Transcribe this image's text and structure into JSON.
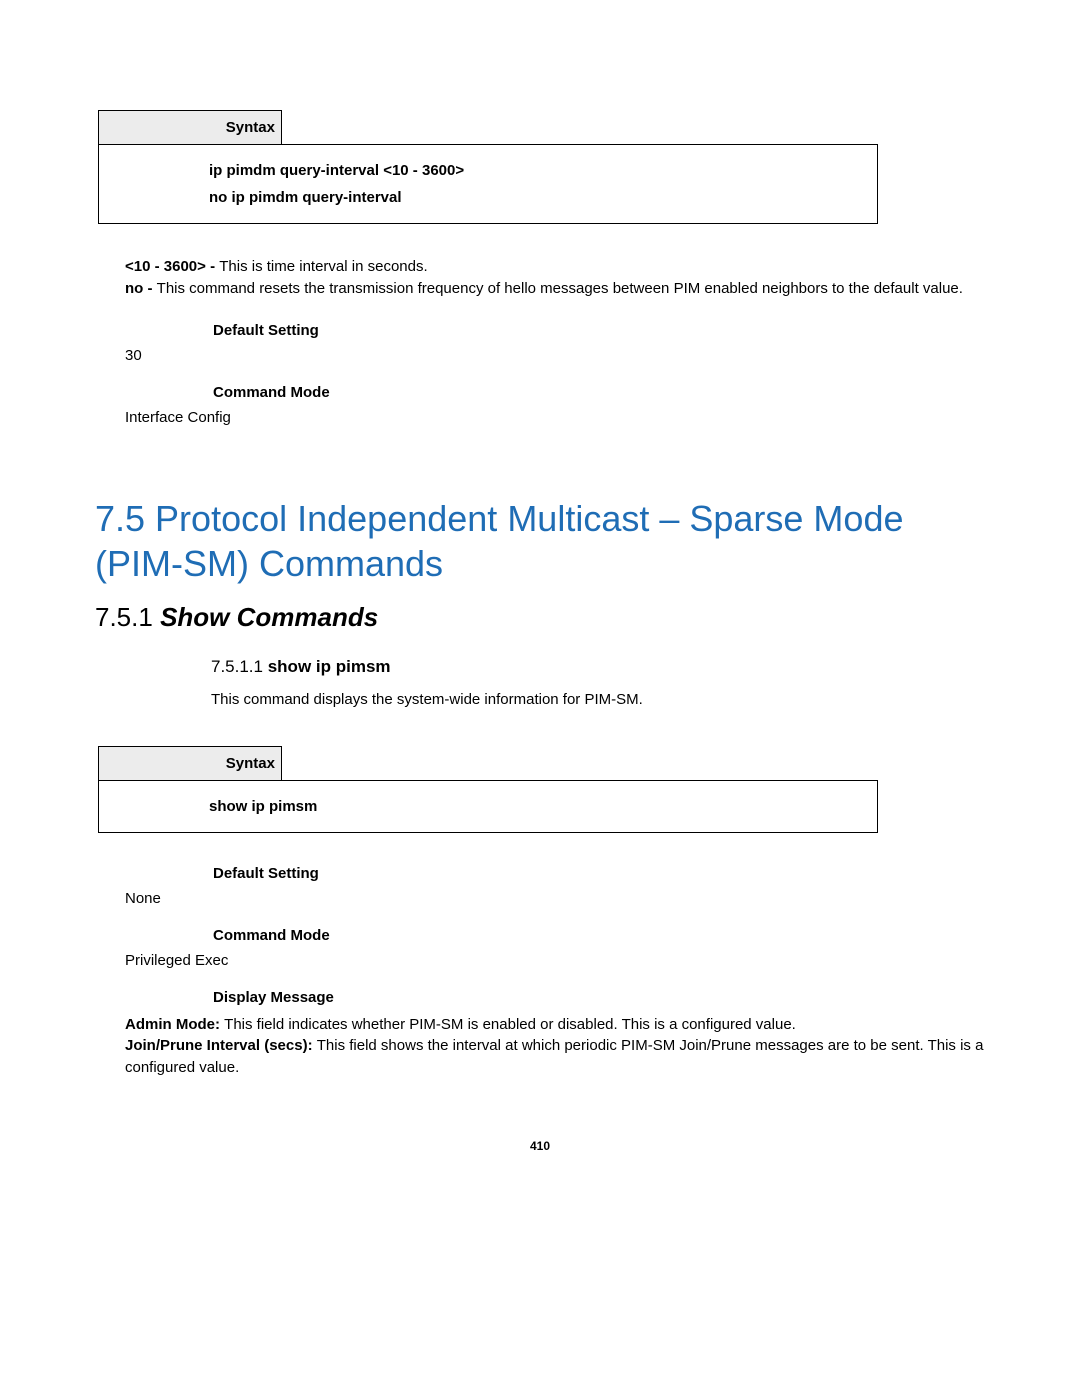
{
  "syntax1": {
    "header": "Syntax",
    "line1": "ip pimdm query-interval <10 - 3600>",
    "line2": "no ip pimdm query-interval"
  },
  "params": {
    "range_term": "<10 - 3600> - ",
    "range_text": "This is time interval in seconds.",
    "no_term": "no - ",
    "no_text": "This command resets the transmission frequency of hello messages between PIM enabled neighbors to the default value."
  },
  "labels": {
    "default_setting": "Default Setting",
    "command_mode": "Command Mode",
    "display_message": "Display Message"
  },
  "values1": {
    "default_setting": "30",
    "command_mode": "Interface Config"
  },
  "section": {
    "title": "7.5 Protocol Independent Multicast – Sparse Mode (PIM-SM) Commands",
    "sub_num": "7.5.1 ",
    "sub_txt": "Show Commands",
    "cmd_num": "7.5.1.1 ",
    "cmd_txt": "show ip pimsm",
    "cmd_desc": "This command displays the system-wide information for PIM-SM."
  },
  "syntax2": {
    "header": "Syntax",
    "line1": "show ip pimsm"
  },
  "values2": {
    "default_setting": "None",
    "command_mode": "Privileged Exec"
  },
  "display_msg": {
    "admin_term": "Admin Mode: ",
    "admin_text": "This field indicates whether PIM-SM is enabled or disabled. This is a configured value.",
    "jp_term": "Join/Prune Interval (secs): ",
    "jp_text": "This field shows the interval at which periodic PIM-SM Join/Prune messages are to be sent. This is a configured value."
  },
  "page_number": "410"
}
